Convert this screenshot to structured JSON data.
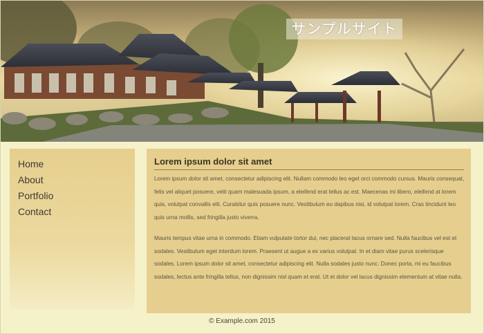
{
  "header": {
    "site_title": "サンプルサイト"
  },
  "sidebar": {
    "items": [
      {
        "label": "Home"
      },
      {
        "label": "About"
      },
      {
        "label": "Portfolio"
      },
      {
        "label": "Contact"
      }
    ]
  },
  "main": {
    "heading": "Lorem ipsum dolor sit amet",
    "paragraphs": [
      "Lorem ipsum dolor sit amet, consectetur adipiscing elit. Nullam commodo leo eget orci commodo cursus. Mauris consequat, felis vel aliquet posuere, velit quam malesuada ipsum, a eleifend erat tellus ac est. Maecenas mi libero, eleifend at lorem quis, volutpat convallis elit. Curabitur quis posuere nunc. Vestibulum eu dapibus nisi, id volutpat lorem. Cras tincidunt leo quis urna mollis, sed fringilla justo viverra.",
      "Mauris tempus vitae urna in commodo. Etiam vulputate tortor dui, nec placerat lacus ornare sed. Nulla faucibus vel est et sodales. Vestibulum eget interdum lorem. Praesent ut augue a ex varius volutpat. In et diam vitae purus scelerisque sodales. Lorem ipsum dolor sit amet, consectetur adipiscing elit. Nulla sodales justo nunc. Donec porta, mi eu faucibus sodales, lectus ante fringilla tellus, non dignissim nisl quam et erat. Ut et dolor vel lacus dignissim elementum at vitae nulla."
    ]
  },
  "footer": {
    "copyright": "© Example.com 2015"
  }
}
